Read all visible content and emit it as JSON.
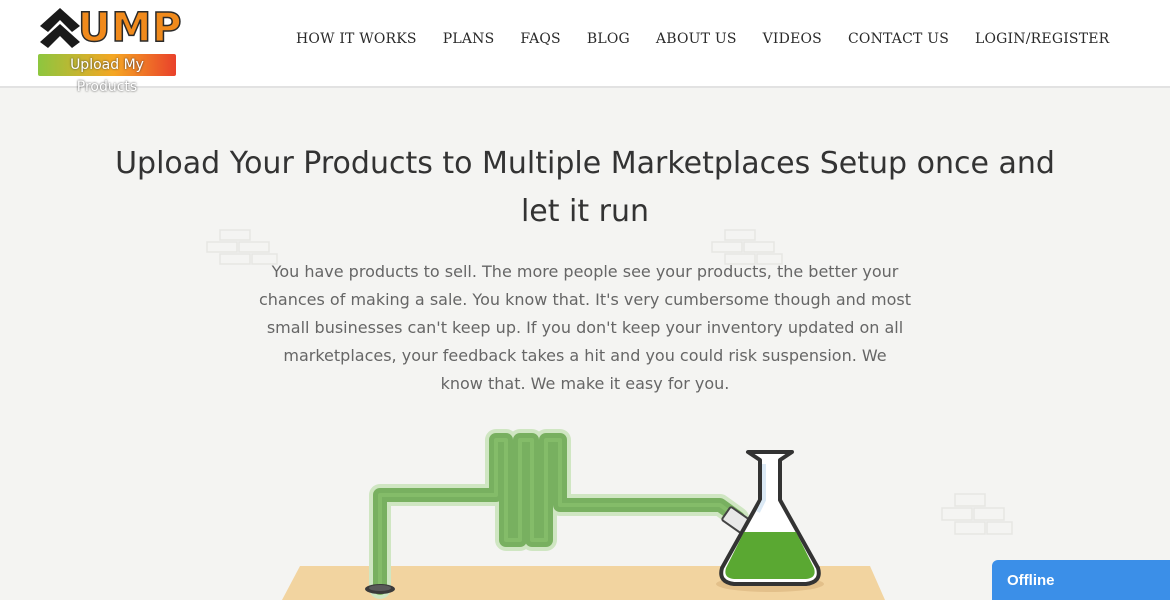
{
  "header": {
    "logo": {
      "main": "UMP",
      "tagline": "Upload My Products"
    },
    "nav": [
      {
        "label": "HOW IT WORKS"
      },
      {
        "label": "PLANS"
      },
      {
        "label": "FAQS"
      },
      {
        "label": "BLOG"
      },
      {
        "label": "ABOUT US"
      },
      {
        "label": "VIDEOS"
      },
      {
        "label": "CONTACT US"
      },
      {
        "label": "LOGIN/REGISTER"
      }
    ]
  },
  "hero": {
    "title_line1": "Upload Your Products to Multiple Marketplaces Setup once and",
    "title_line2": "let it run",
    "body_line1": "You have products to sell. The more people see your products, the better your",
    "body_line2": "chances of making a sale. You know that. It's very cumbersome though and most",
    "body_line3": "small businesses can't keep up. If you don't keep your inventory updated on all",
    "body_line4": "marketplaces, your feedback takes a hit and you could risk suspension. We",
    "body_line5": "know that. We make it easy for you."
  },
  "chat_widget": {
    "status": "Offline",
    "color": "#3b8fe8"
  },
  "colors": {
    "pipe": "#78b060",
    "liquid": "#5aa832",
    "table": "#f2d4a0"
  }
}
